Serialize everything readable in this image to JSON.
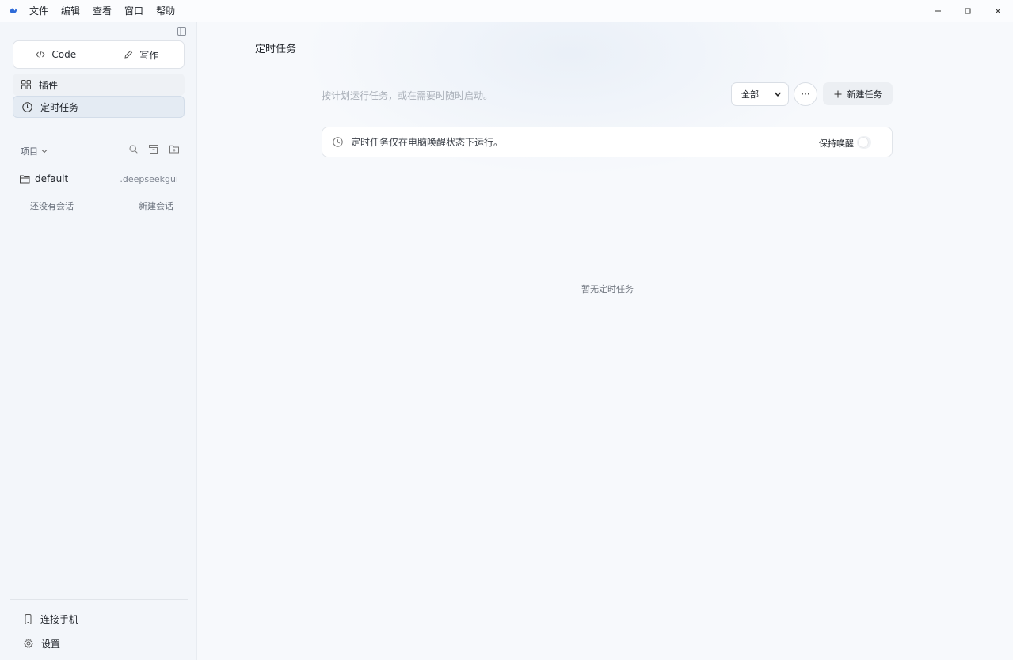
{
  "menu": {
    "items": [
      "文件",
      "编辑",
      "查看",
      "窗口",
      "帮助"
    ]
  },
  "window_controls": {
    "minimize": "—",
    "maximize": "☐",
    "close": "✕"
  },
  "sidebar": {
    "modes": [
      {
        "label": "Code",
        "icon": "code-icon"
      },
      {
        "label": "写作",
        "icon": "pencil-icon"
      }
    ],
    "nav": [
      {
        "label": "插件",
        "icon": "grid-icon"
      },
      {
        "label": "定时任务",
        "icon": "clock-icon",
        "active": true
      }
    ],
    "projects_label": "项目",
    "project": {
      "name": "default",
      "path": ".deepseekgui"
    },
    "session": {
      "empty_label": "还没有会话",
      "new_label": "新建会话"
    },
    "bottom": [
      {
        "label": "连接手机",
        "icon": "phone-icon"
      },
      {
        "label": "设置",
        "icon": "gear-icon"
      }
    ]
  },
  "main": {
    "title": "定时任务",
    "subtitle": "按计划运行任务，或在需要时随时启动。",
    "filter": {
      "selected": "全部"
    },
    "more_label": "···",
    "new_task_label": "新建任务",
    "notice": {
      "text": "定时任务仅在电脑唤醒状态下运行。",
      "toggle_label": "保持唤醒",
      "toggle_on": false
    },
    "empty_state": "暂无定时任务"
  },
  "colors": {
    "accent": "#2f6bd8",
    "sidebar_bg": "#f3f6fa",
    "active_nav_bg": "#e4ebf3"
  }
}
